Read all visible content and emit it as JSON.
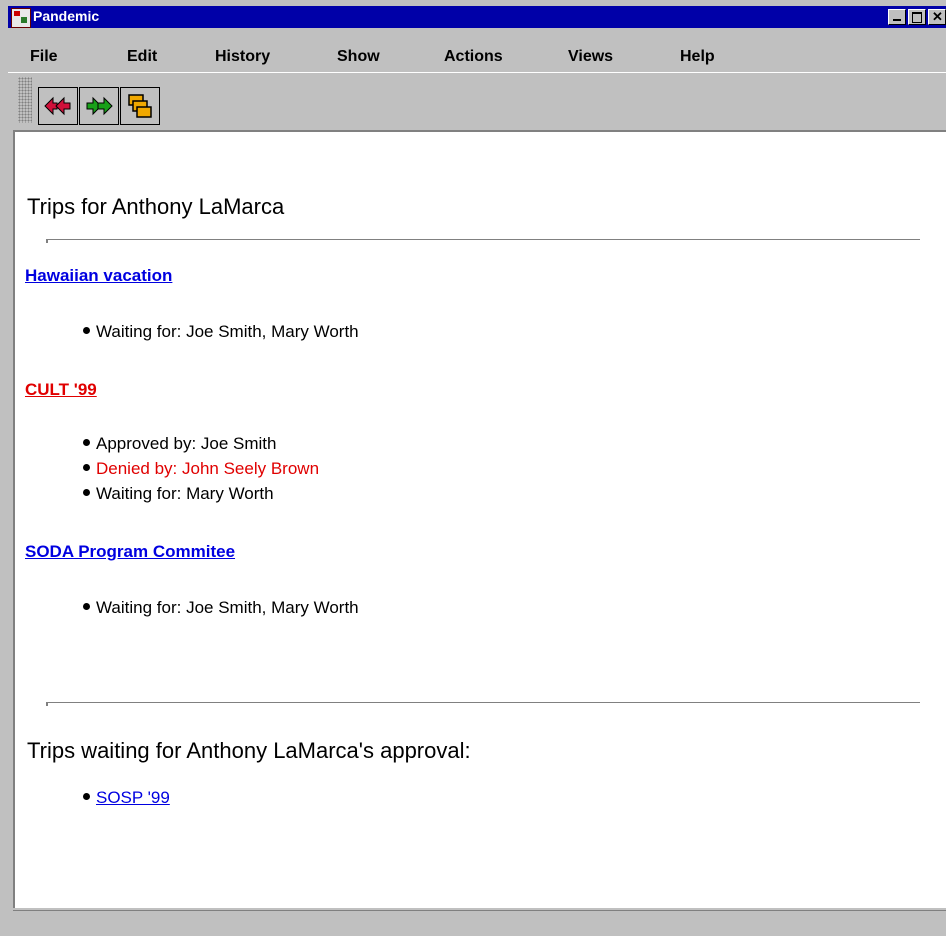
{
  "window": {
    "title": "Pandemic"
  },
  "menubar": {
    "items": [
      {
        "label": "File"
      },
      {
        "label": "Edit"
      },
      {
        "label": "History"
      },
      {
        "label": "Show"
      },
      {
        "label": "Actions"
      },
      {
        "label": "Views"
      },
      {
        "label": "Help"
      }
    ]
  },
  "toolbar": {
    "buttons": [
      {
        "icon": "back-arrow-icon"
      },
      {
        "icon": "forward-arrow-icon"
      },
      {
        "icon": "windows-icon"
      }
    ]
  },
  "main": {
    "trips_heading": "Trips for Anthony LaMarca",
    "trips": [
      {
        "name": "Hawaiian vacation",
        "status_color": "#0000e0",
        "details": [
          {
            "text": "Waiting for: Joe Smith, Mary Worth",
            "color": "#000000"
          }
        ]
      },
      {
        "name": "CULT '99",
        "status_color": "#e00000",
        "details": [
          {
            "text": "Approved by: Joe Smith",
            "color": "#000000"
          },
          {
            "text": "Denied by: John Seely Brown",
            "color": "#e00000"
          },
          {
            "text": "Waiting for: Mary Worth",
            "color": "#000000"
          }
        ]
      },
      {
        "name": "SODA Program Commitee",
        "status_color": "#0000e0",
        "details": [
          {
            "text": "Waiting for: Joe Smith, Mary Worth",
            "color": "#000000"
          }
        ]
      }
    ],
    "approval_heading": "Trips waiting for Anthony LaMarca's approval:",
    "approval_items": [
      {
        "label": "SOSP '99"
      }
    ]
  },
  "colors": {
    "titlebar": "#0000a8",
    "link_blue": "#0000e0",
    "denied_red": "#e00000",
    "chrome": "#c0c0c0"
  }
}
